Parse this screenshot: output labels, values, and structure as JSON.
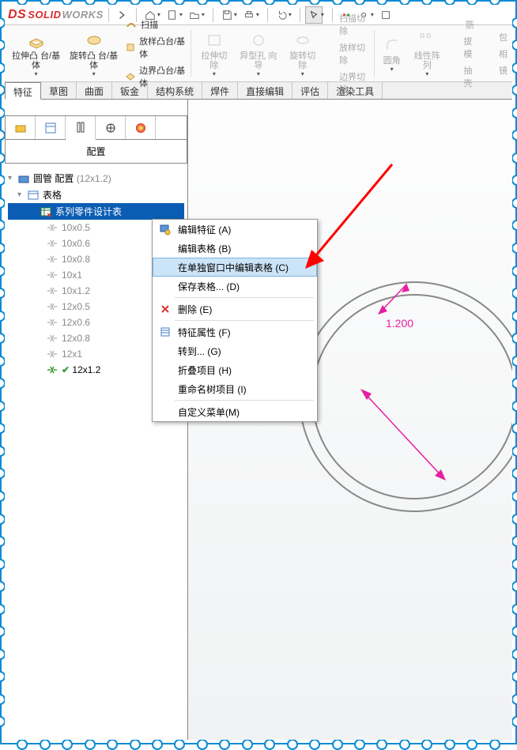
{
  "app": {
    "name": "SOLID",
    "name2": "WORKS"
  },
  "toolbar": {
    "home": "home",
    "arrow_l": "<",
    "arrow_r": ">",
    "save": "save",
    "print": "print",
    "select": "select"
  },
  "ribbon": {
    "extrude": "拉伸凸\n台/基体",
    "revolve": "旋转凸\n台/基体",
    "sweep": "扫描",
    "loft": "放样凸台/基体",
    "boundary": "边界凸台/基体",
    "extrude_cut": "拉伸切\n除",
    "hole": "异型孔\n向导",
    "revolve_cut": "旋转切\n除",
    "sweep_cut": "扫描切除",
    "loft_cut": "放样切除",
    "boundary_cut": "边界切除",
    "fillet": "圆角",
    "linpat": "线性阵\n列",
    "rib": "筋",
    "draft": "拔模",
    "shell": "抽壳",
    "wrap": "包",
    "intersect": "相",
    "mirror": "镜"
  },
  "tabs": [
    "特征",
    "草图",
    "曲面",
    "钣金",
    "结构系统",
    "焊件",
    "直接编辑",
    "评估",
    "渲染工具"
  ],
  "panel": {
    "title": "配置"
  },
  "tree": {
    "root": "圆管 配置",
    "root_suffix": "(12x1.2)",
    "table": "表格",
    "design_table": "系列零件设计表",
    "configs": [
      "10x0.5",
      "10x0.6",
      "10x0.8",
      "10x1",
      "10x1.2",
      "12x0.5",
      "12x0.6",
      "12x0.8",
      "12x1",
      "12x1.2"
    ]
  },
  "ctx": {
    "edit_feature": "编辑特征  (A)",
    "edit_table": "编辑表格  (B)",
    "edit_table_window": "在单独窗口中编辑表格  (C)",
    "save_table": "保存表格...  (D)",
    "delete": "删除  (E)",
    "props": "特征属性  (F)",
    "goto": "转到...  (G)",
    "collapse": "折叠项目  (H)",
    "rename": "重命名树项目  (I)",
    "custom": "自定义菜单(M)"
  },
  "dim": {
    "value": "1.200"
  }
}
